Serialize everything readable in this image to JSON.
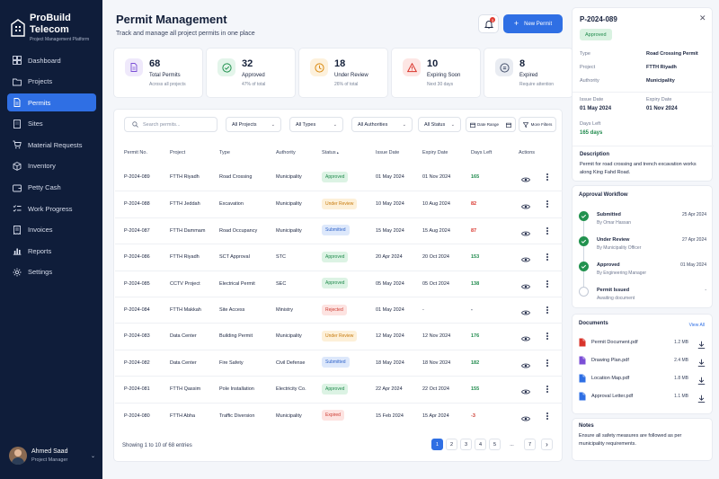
{
  "app": {
    "name": "ProBuild Telecom",
    "tagline": "Project Management Platform"
  },
  "sidebar": {
    "items": [
      {
        "label": "Dashboard",
        "icon": "dashboard-icon"
      },
      {
        "label": "Projects",
        "icon": "folder-icon"
      },
      {
        "label": "Permits",
        "icon": "document-icon",
        "active": true
      },
      {
        "label": "Sites",
        "icon": "building-icon"
      },
      {
        "label": "Material Requests",
        "icon": "cart-icon"
      },
      {
        "label": "Inventory",
        "icon": "box-icon"
      },
      {
        "label": "Petty Cash",
        "icon": "wallet-icon"
      },
      {
        "label": "Work Progress",
        "icon": "checklist-icon"
      },
      {
        "label": "Invoices",
        "icon": "receipt-icon"
      },
      {
        "label": "Reports",
        "icon": "chart-icon"
      },
      {
        "label": "Settings",
        "icon": "gear-icon"
      }
    ]
  },
  "user": {
    "name": "Ahmed Saad",
    "role": "Project Manager"
  },
  "header": {
    "title": "Permit Management",
    "subtitle": "Track and manage all project permits in one place",
    "notifications": "3",
    "new_button": "New Permit"
  },
  "stats": [
    {
      "value": "68",
      "label": "Total Permits",
      "sub": "Across all projects",
      "icon": "document-icon",
      "color": "#7b4fd6",
      "bg": "#efe9fb"
    },
    {
      "value": "32",
      "label": "Approved",
      "sub": "47% of total",
      "icon": "check-circle-icon",
      "color": "#22924f",
      "bg": "#e3f5ea"
    },
    {
      "value": "18",
      "label": "Under Review",
      "sub": "26% of total",
      "icon": "clock-icon",
      "color": "#d98a12",
      "bg": "#fdf1dc"
    },
    {
      "value": "10",
      "label": "Expiring Soon",
      "sub": "Next 30 days",
      "icon": "warning-icon",
      "color": "#d9342b",
      "bg": "#fde6e4"
    },
    {
      "value": "8",
      "label": "Expired",
      "sub": "Require attention",
      "icon": "expired-icon",
      "color": "#4a5570",
      "bg": "#e9ecf2"
    }
  ],
  "filters": {
    "search_placeholder": "Search permits...",
    "projects": "All Projects",
    "types": "All Types",
    "authorities": "All Authorities",
    "status": "All Status",
    "date_range": "Date Range",
    "more_filters": "More Filters"
  },
  "table": {
    "columns": [
      "Permit No.",
      "Project",
      "Type",
      "Authority",
      "Status",
      "Issue Date",
      "Expiry Date",
      "Days Left",
      "Actions"
    ],
    "rows": [
      {
        "permit": "P-2024-089",
        "project": "FTTH Riyadh",
        "type": "Road Crossing",
        "authority": "Municipality",
        "status": "Approved",
        "issue": "01 May 2024",
        "expiry": "01 Nov 2024",
        "days": "165"
      },
      {
        "permit": "P-2024-088",
        "project": "FTTH Jeddah",
        "type": "Excavation",
        "authority": "Municipality",
        "status": "Under Review",
        "issue": "10 May 2024",
        "expiry": "10 Aug 2024",
        "days": "82"
      },
      {
        "permit": "P-2024-087",
        "project": "FTTH Dammam",
        "type": "Road Occupancy",
        "authority": "Municipality",
        "status": "Submitted",
        "issue": "15 May 2024",
        "expiry": "15 Aug 2024",
        "days": "87"
      },
      {
        "permit": "P-2024-086",
        "project": "FTTH Riyadh",
        "type": "SCT Approval",
        "authority": "STC",
        "status": "Approved",
        "issue": "20 Apr 2024",
        "expiry": "20 Oct 2024",
        "days": "153"
      },
      {
        "permit": "P-2024-085",
        "project": "CCTV Project",
        "type": "Electrical Permit",
        "authority": "SEC",
        "status": "Approved",
        "issue": "05 May 2024",
        "expiry": "05 Oct 2024",
        "days": "138"
      },
      {
        "permit": "P-2024-084",
        "project": "FTTH Makkah",
        "type": "Site Access",
        "authority": "Ministry",
        "status": "Rejected",
        "issue": "01 May 2024",
        "expiry": "-",
        "days": "-"
      },
      {
        "permit": "P-2024-083",
        "project": "Data Center",
        "type": "Building Permit",
        "authority": "Municipality",
        "status": "Under Review",
        "issue": "12 May 2024",
        "expiry": "12 Nov 2024",
        "days": "176"
      },
      {
        "permit": "P-2024-082",
        "project": "Data Center",
        "type": "Fire Safety",
        "authority": "Civil Defense",
        "status": "Submitted",
        "issue": "18 May 2024",
        "expiry": "18 Nov 2024",
        "days": "182"
      },
      {
        "permit": "P-2024-081",
        "project": "FTTH Qassim",
        "type": "Pole Installation",
        "authority": "Electricity Co.",
        "status": "Approved",
        "issue": "22 Apr 2024",
        "expiry": "22 Oct 2024",
        "days": "155"
      },
      {
        "permit": "P-2024-080",
        "project": "FTTH Abha",
        "type": "Traffic Diversion",
        "authority": "Municipality",
        "status": "Expired",
        "issue": "15 Feb 2024",
        "expiry": "15 Apr 2024",
        "days": "-3"
      }
    ]
  },
  "status_colors": {
    "Approved": {
      "bg": "#dcf3e4",
      "fg": "#1f8a4c"
    },
    "Under Review": {
      "bg": "#fdf0d8",
      "fg": "#c77a0c"
    },
    "Submitted": {
      "bg": "#dde8fb",
      "fg": "#2f63c9"
    },
    "Rejected": {
      "bg": "#fde3e1",
      "fg": "#cc3a30"
    },
    "Expired": {
      "bg": "#fde3e1",
      "fg": "#cc3a30"
    }
  },
  "pagination": {
    "showing": "Showing 1 to 10 of 68 entries",
    "pages": [
      "1",
      "2",
      "3",
      "4",
      "5",
      "...",
      "7"
    ],
    "current": "1"
  },
  "detail": {
    "permit": "P-2024-089",
    "status": "Approved",
    "fields": [
      {
        "label": "Type",
        "value": "Road Crossing Permit"
      },
      {
        "label": "Project",
        "value": "FTTH Riyadh"
      },
      {
        "label": "Authority",
        "value": "Municipality"
      }
    ],
    "issue_label": "Issue Date",
    "issue_value": "01 May 2024",
    "expiry_label": "Expiry Date",
    "expiry_value": "01 Nov 2024",
    "days_label": "Days Left",
    "days_value": "165 days",
    "desc_label": "Description",
    "desc_value": "Permit for road crossing and trench excavation works along King Fahd Road."
  },
  "workflow": {
    "title": "Approval Workflow",
    "steps": [
      {
        "name": "Submitted",
        "by": "By Omar Hassan",
        "date": "25 Apr 2024",
        "done": true
      },
      {
        "name": "Under Review",
        "by": "By Municipality Officer",
        "date": "27 Apr 2024",
        "done": true
      },
      {
        "name": "Approved",
        "by": "By Engineering Manager",
        "date": "01 May 2024",
        "done": true
      },
      {
        "name": "Permit Issued",
        "by": "Awaiting document",
        "date": "-",
        "done": false
      }
    ]
  },
  "documents": {
    "title": "Documents",
    "view_all": "View All",
    "files": [
      {
        "name": "Permit Document.pdf",
        "size": "1.2 MB",
        "color": "#d9342b"
      },
      {
        "name": "Drawing Plan.pdf",
        "size": "2.4 MB",
        "color": "#7b4fd6"
      },
      {
        "name": "Location Map.pdf",
        "size": "1.8 MB",
        "color": "#2f6fe4"
      },
      {
        "name": "Approval Letter.pdf",
        "size": "1.1 MB",
        "color": "#2f6fe4"
      }
    ]
  },
  "notes": {
    "title": "Notes",
    "text": "Ensure all safety measures are followed as per municipality requirements."
  }
}
